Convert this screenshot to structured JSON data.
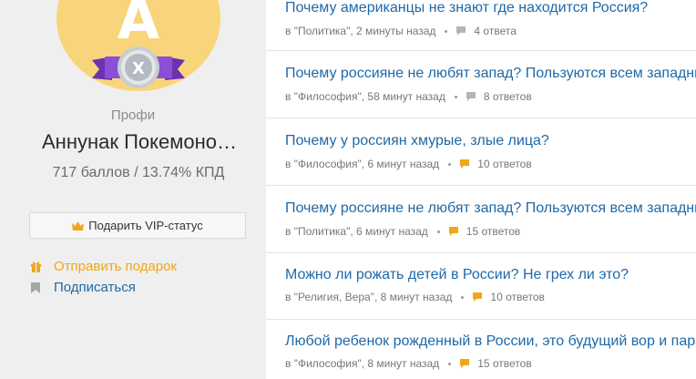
{
  "profile": {
    "avatar_letter": "А",
    "badge_letter": "X",
    "rank": "Профи",
    "name": "Аннунак Покемоно…",
    "score": "717 баллов / 13.74% КПД",
    "vip_button_label": "Подарить VIP-статус",
    "gift_link_label": "Отправить подарок",
    "subscribe_link_label": "Подписаться"
  },
  "colors": {
    "link_blue": "#1e69a8",
    "accent_orange": "#f0a61b",
    "avatar_yellow": "#f8d57a",
    "badge_purple": "#7b3fc4",
    "bubble_gray": "#b5b5b5",
    "bubble_orange": "#f0a61b"
  },
  "questions": [
    {
      "title": "Почему американцы не знают где находится Россия?",
      "category": "в \"Политика\"",
      "time": "2 минуты назад",
      "answers": "4 ответа",
      "bubble": "gray"
    },
    {
      "title": "Почему россияне не любят запад? Пользуются всем западным",
      "category": "в \"Философия\"",
      "time": "58 минут назад",
      "answers": "8 ответов",
      "bubble": "gray"
    },
    {
      "title": "Почему у россиян хмурые, злые лица?",
      "category": "в \"Философия\"",
      "time": "6 минут назад",
      "answers": "10 ответов",
      "bubble": "orange"
    },
    {
      "title": "Почему россияне не любят запад? Пользуются всем западным",
      "category": "в \"Политика\"",
      "time": "6 минут назад",
      "answers": "15 ответов",
      "bubble": "orange"
    },
    {
      "title": "Можно ли рожать детей в России? Не грех ли это?",
      "category": "в \"Религия, Вера\"",
      "time": "8 минут назад",
      "answers": "10 ответов",
      "bubble": "orange"
    },
    {
      "title": "Любой ребенок рожденный в России, это будущий вор и паразит",
      "category": "в \"Философия\"",
      "time": "8 минут назад",
      "answers": "15 ответов",
      "bubble": "orange"
    }
  ]
}
